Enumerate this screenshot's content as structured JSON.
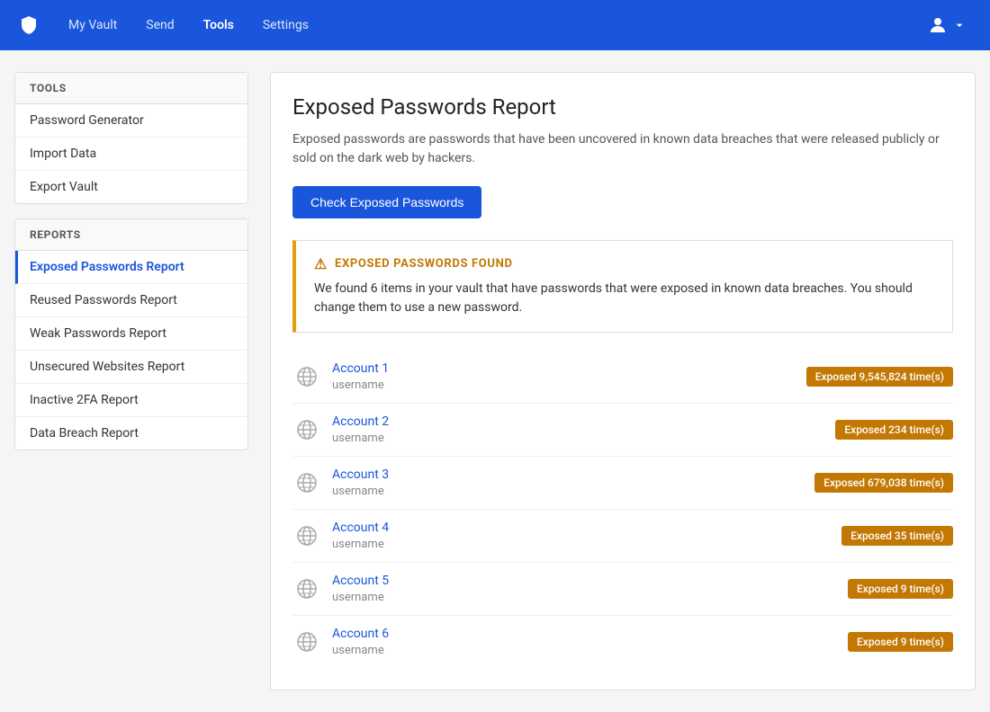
{
  "navbar": {
    "logo_alt": "Bitwarden",
    "links": [
      {
        "label": "My Vault",
        "active": false
      },
      {
        "label": "Send",
        "active": false
      },
      {
        "label": "Tools",
        "active": true
      },
      {
        "label": "Settings",
        "active": false
      }
    ],
    "user_icon": "user-circle"
  },
  "sidebar": {
    "tools_header": "TOOLS",
    "tools_items": [
      {
        "label": "Password Generator"
      },
      {
        "label": "Import Data"
      },
      {
        "label": "Export Vault"
      }
    ],
    "reports_header": "REPORTS",
    "reports_items": [
      {
        "label": "Exposed Passwords Report",
        "active": true
      },
      {
        "label": "Reused Passwords Report",
        "active": false
      },
      {
        "label": "Weak Passwords Report",
        "active": false
      },
      {
        "label": "Unsecured Websites Report",
        "active": false
      },
      {
        "label": "Inactive 2FA Report",
        "active": false
      },
      {
        "label": "Data Breach Report",
        "active": false
      }
    ]
  },
  "main": {
    "title": "Exposed Passwords Report",
    "description": "Exposed passwords are passwords that have been uncovered in known data breaches that were released publicly or sold on the dark web by hackers.",
    "check_button": "Check Exposed Passwords",
    "alert": {
      "title": "EXPOSED PASSWORDS FOUND",
      "body": "We found 6 items in your vault that have passwords that were exposed in known data breaches. You should change them to use a new password."
    },
    "accounts": [
      {
        "name": "Account 1",
        "username": "username",
        "badge": "Exposed 9,545,824 time(s)"
      },
      {
        "name": "Account 2",
        "username": "username",
        "badge": "Exposed 234 time(s)"
      },
      {
        "name": "Account 3",
        "username": "username",
        "badge": "Exposed 679,038 time(s)"
      },
      {
        "name": "Account 4",
        "username": "username",
        "badge": "Exposed 35 time(s)"
      },
      {
        "name": "Account 5",
        "username": "username",
        "badge": "Exposed 9 time(s)"
      },
      {
        "name": "Account 6",
        "username": "username",
        "badge": "Exposed 9 time(s)"
      }
    ]
  }
}
